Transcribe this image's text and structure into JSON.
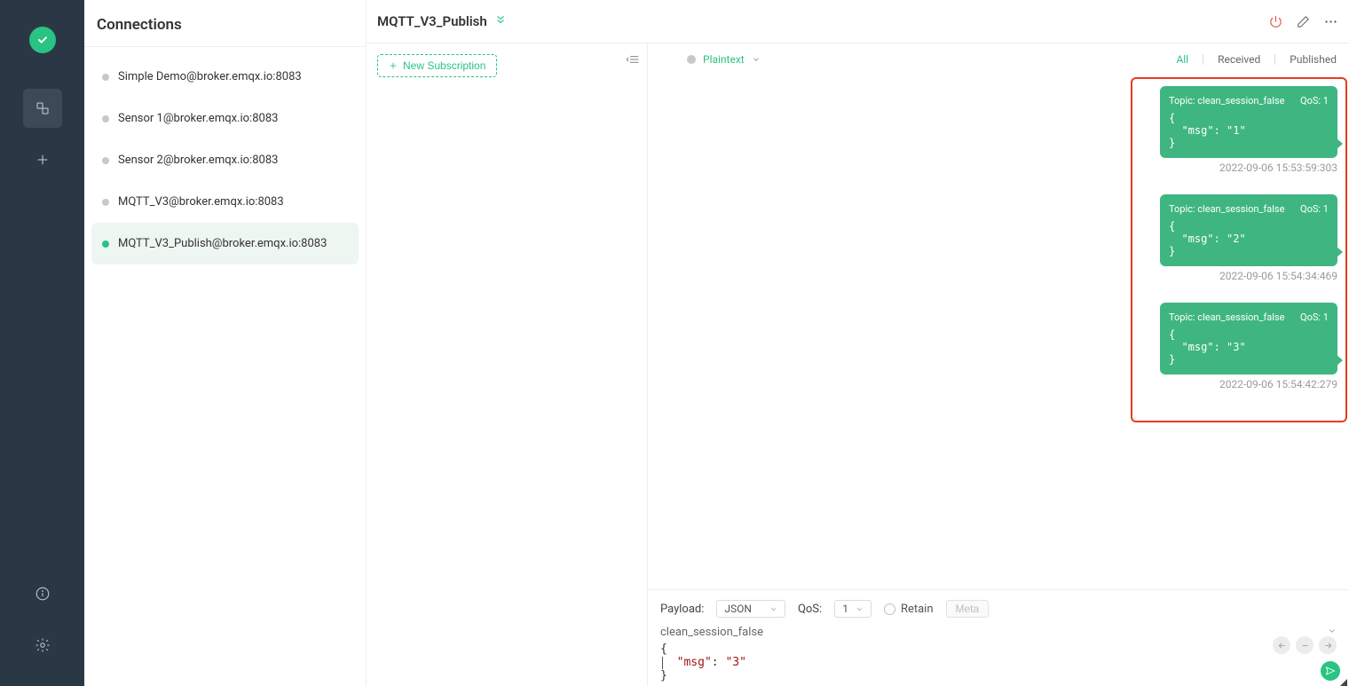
{
  "sidebar": {},
  "connections": {
    "title": "Connections",
    "items": [
      {
        "label": "Simple Demo@broker.emqx.io:8083",
        "color": "#c8c8c8",
        "selected": false
      },
      {
        "label": "Sensor 1@broker.emqx.io:8083",
        "color": "#c8c8c8",
        "selected": false
      },
      {
        "label": "Sensor 2@broker.emqx.io:8083",
        "color": "#c8c8c8",
        "selected": false
      },
      {
        "label": "MQTT_V3@broker.emqx.io:8083",
        "color": "#c8c8c8",
        "selected": false
      },
      {
        "label": "MQTT_V3_Publish@broker.emqx.io:8083",
        "color": "#29c383",
        "selected": true
      }
    ]
  },
  "header": {
    "title": "MQTT_V3_Publish"
  },
  "subscriptions": {
    "new_button": "New Subscription"
  },
  "msgs_toolbar": {
    "format": "Plaintext",
    "tabs": {
      "all": "All",
      "received": "Received",
      "published": "Published"
    }
  },
  "messages": [
    {
      "topic_label": "Topic: clean_session_false",
      "qos_label": "QoS: 1",
      "payload": "{\n  \"msg\": \"1\"\n}",
      "timestamp": "2022-09-06 15:53:59:303"
    },
    {
      "topic_label": "Topic: clean_session_false",
      "qos_label": "QoS: 1",
      "payload": "{\n  \"msg\": \"2\"\n}",
      "timestamp": "2022-09-06 15:54:34:469"
    },
    {
      "topic_label": "Topic: clean_session_false",
      "qos_label": "QoS: 1",
      "payload": "{\n  \"msg\": \"3\"\n}",
      "timestamp": "2022-09-06 15:54:42:279"
    }
  ],
  "compose": {
    "payload_label": "Payload:",
    "payload_type": "JSON",
    "qos_label": "QoS:",
    "qos_value": "1",
    "retain_label": "Retain",
    "meta_label": "Meta",
    "topic_value": "clean_session_false",
    "payload_key": "\"msg\"",
    "payload_val": "\"3\""
  }
}
